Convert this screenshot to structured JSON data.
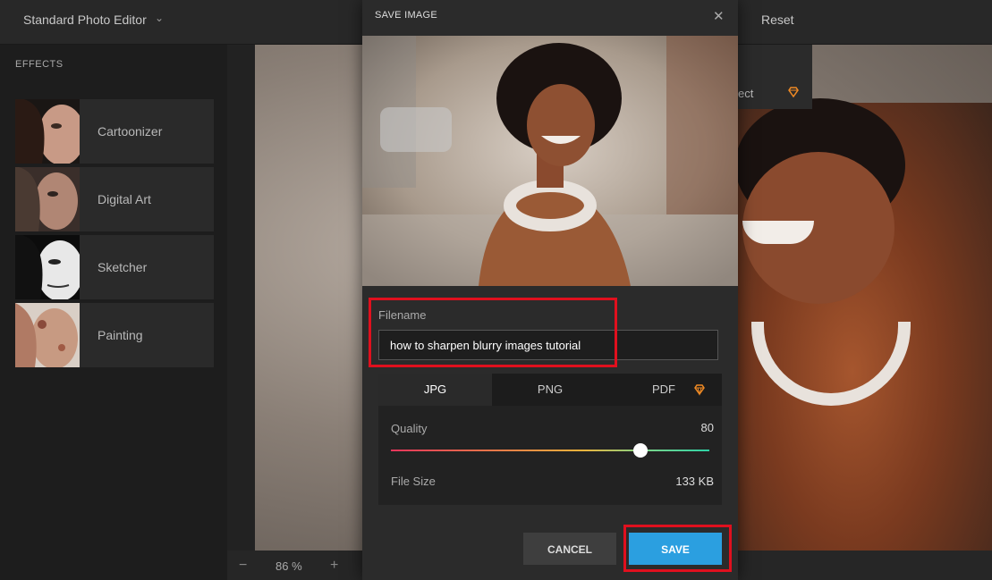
{
  "topbar": {
    "app_title": "Standard Photo Editor",
    "reset_label": "Reset"
  },
  "sidebar": {
    "title": "EFFECTS",
    "items": [
      {
        "label": "Cartoonizer"
      },
      {
        "label": "Digital Art"
      },
      {
        "label": "Sketcher"
      },
      {
        "label": "Painting"
      }
    ]
  },
  "popover": {
    "partial_text": "ect"
  },
  "zoom": {
    "value": "86 %",
    "minus": "−",
    "plus": "+"
  },
  "modal": {
    "title": "SAVE IMAGE",
    "close_glyph": "✕",
    "filename_label": "Filename",
    "filename_value": "how to sharpen blurry images tutorial",
    "tabs": [
      {
        "label": "JPG"
      },
      {
        "label": "PNG"
      },
      {
        "label": "PDF"
      }
    ],
    "selected_format": "JPG",
    "quality_label": "Quality",
    "quality_value": "80",
    "filesize_label": "File Size",
    "filesize_value": "133 KB",
    "cancel_label": "CANCEL",
    "save_label": "SAVE"
  },
  "colors": {
    "accent": "#2b9fe0",
    "highlight": "#e0101e",
    "premium": "#f08a24"
  }
}
